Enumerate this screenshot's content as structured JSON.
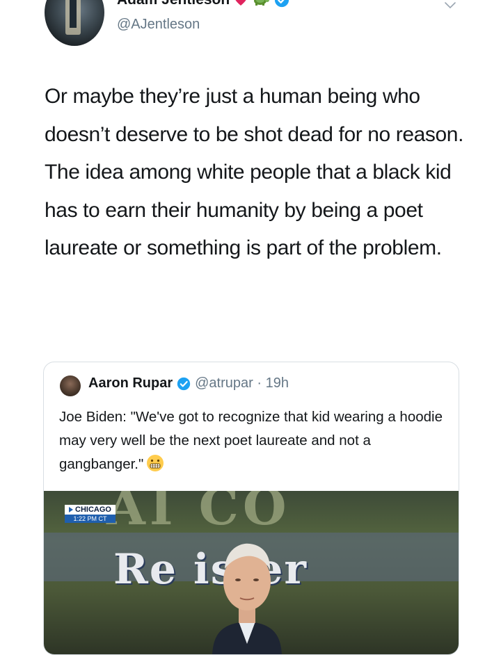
{
  "tweet": {
    "display_name": "Adam Jentleson",
    "handle": "@AJentleson",
    "name_emojis": [
      "balloon-heart-emoji",
      "turtle-emoji"
    ],
    "text": "Or maybe they’re just a human being who doesn’t deserve to be shot dead for no reason. The idea among white people that a black kid has to earn their humanity by being a poet laureate or something is part of the problem."
  },
  "quote": {
    "display_name": "Aaron Rupar",
    "handle_time": "@atrupar · 19h",
    "text": "Joe Biden: \"We've got to recognize that kid wearing a hoodie may very well be the next poet laureate and not a gangbanger.\"",
    "text_emoji": "grimacing-face-emoji"
  },
  "media": {
    "location_label": "CHICAGO",
    "time_label": "1:22 PM CT",
    "sign_top_text": "AI  CO",
    "sign_bottom_text": "Re ister"
  },
  "colors": {
    "text": "#14171a",
    "secondary": "#657786",
    "verified": "#1da1f2",
    "border": "#d8dee3"
  }
}
